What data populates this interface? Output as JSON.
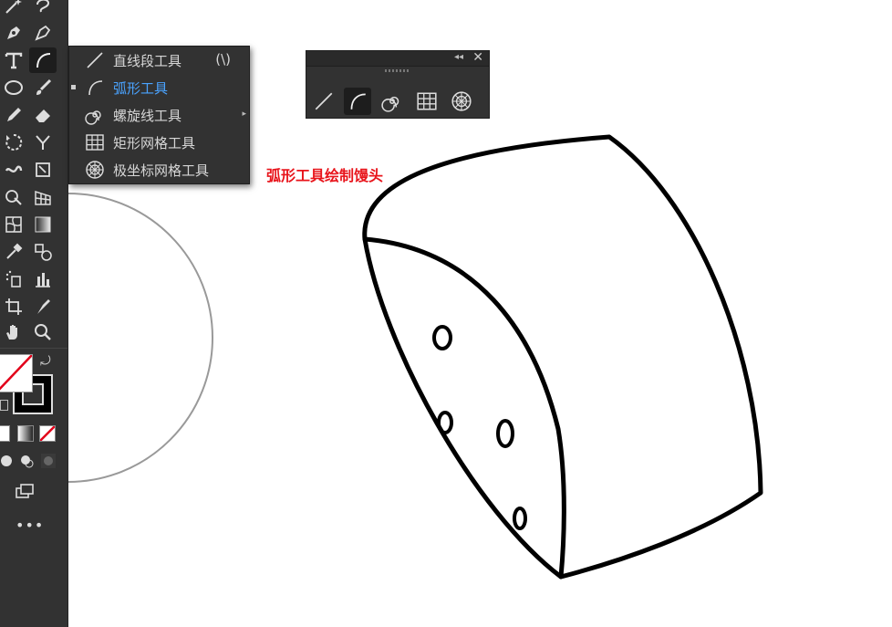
{
  "flyout": {
    "items": [
      {
        "label": "直线段工具",
        "shortcut": "(\\)",
        "icon": "line-segment-icon"
      },
      {
        "label": "弧形工具",
        "shortcut": "",
        "icon": "arc-icon",
        "selected": true
      },
      {
        "label": "螺旋线工具",
        "shortcut": "",
        "icon": "spiral-icon"
      },
      {
        "label": "矩形网格工具",
        "shortcut": "",
        "icon": "rect-grid-icon"
      },
      {
        "label": "极坐标网格工具",
        "shortcut": "",
        "icon": "polar-grid-icon"
      }
    ]
  },
  "panel": {
    "icons": [
      "line-segment-icon",
      "arc-icon",
      "spiral-icon",
      "rect-grid-icon",
      "polar-grid-icon"
    ]
  },
  "annotation": "弧形工具绘制馒头",
  "colors": {
    "ui_bg": "#323232",
    "selected_text": "#4aa3ff",
    "annotation": "#e8141b"
  }
}
